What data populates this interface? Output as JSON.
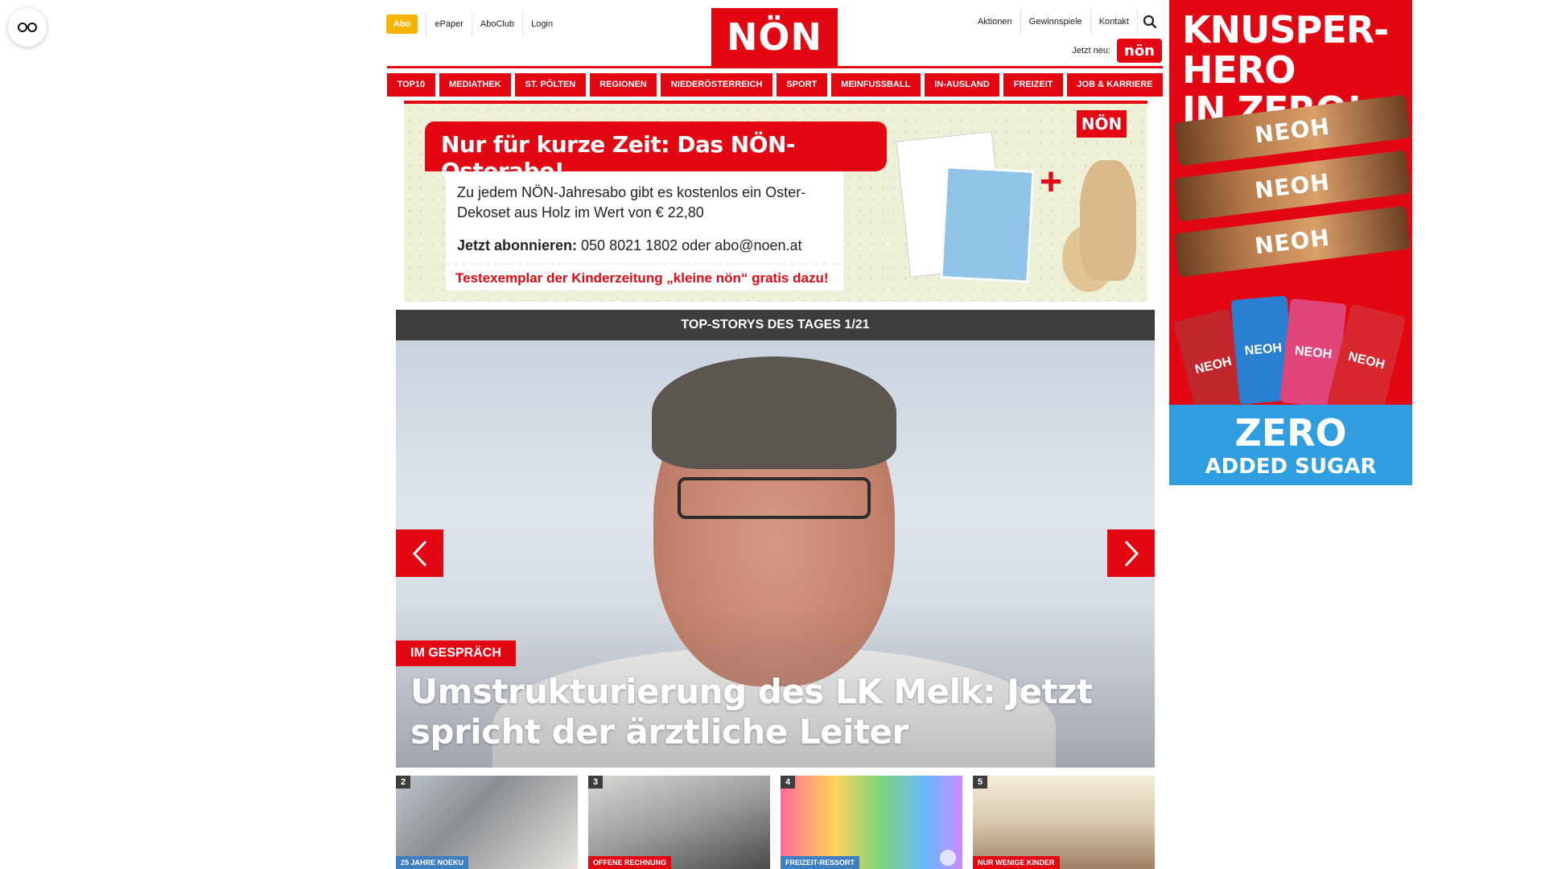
{
  "header": {
    "abo": "Abo",
    "links": [
      "ePaper",
      "AboClub",
      "Login"
    ],
    "logo": "NÖN",
    "right_links": [
      "Aktionen",
      "Gewinnspiele",
      "Kontakt"
    ],
    "jetzt_label": "Jetzt neu:",
    "kleine_logo": "nön"
  },
  "nav": [
    "TOP10",
    "MEDIATHEK",
    "ST. PÖLTEN",
    "REGIONEN",
    "NIEDERÖSTERREICH",
    "SPORT",
    "MEINFUSSBALL",
    "IN-AUSLAND",
    "FREIZEIT",
    "JOB & KARRIERE"
  ],
  "promo": {
    "headline": "Nur für kurze Zeit: Das NÖN-Osterabo!",
    "text": "Zu jedem NÖN-Jahresabo gibt es kostenlos ein Oster-Dekoset aus Holz im Wert von € 22,80",
    "cta_bold": "Jetzt abonnieren:",
    "cta_rest": " 050 8021 1802 oder abo@noen.at",
    "footer": "Testexemplar der Kinderzeitung „kleine nön“ gratis dazu!",
    "logo": "NÖN",
    "plus": "+"
  },
  "stories": {
    "bar_title": "TOP-STORYS DES TAGES 1/21",
    "hero_tag": "IM GESPRÄCH",
    "hero_title": "Umstrukturierung des LK Melk: Jetzt spricht der ärztliche Leiter"
  },
  "thumbs": [
    {
      "num": "2",
      "tag": "25 JAHRE NOEKU"
    },
    {
      "num": "3",
      "tag": "OFFENE RECHNUNG"
    },
    {
      "num": "4",
      "tag": "FREIZEIT-RESSORT"
    },
    {
      "num": "5",
      "tag": "NUR WENIGE KINDER"
    }
  ],
  "ad": {
    "headline_1": "KNUSPER-HERO",
    "headline_2": "IN ZERO!",
    "bar_label": "NEOH",
    "pack_label": "NEOH",
    "footer_big": "ZERO",
    "footer_small": "ADDED SUGAR"
  },
  "colors": {
    "brand_red": "#e30613",
    "abo_yellow": "#f7b500",
    "dark_bar": "#3d3d3d",
    "ad_blue": "#2f9ee0"
  }
}
